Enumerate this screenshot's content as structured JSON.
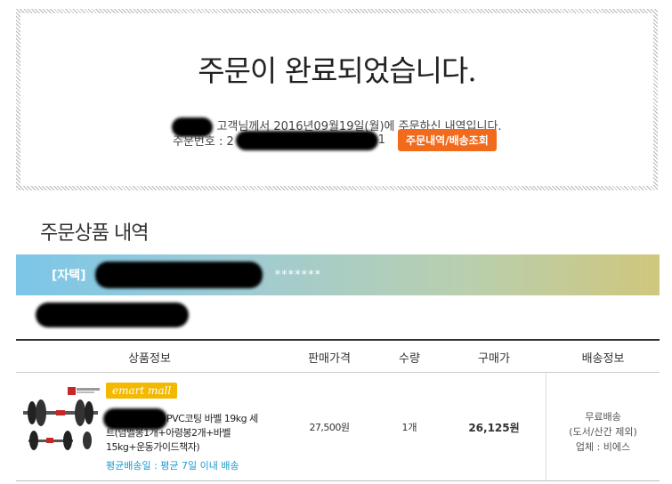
{
  "completion": {
    "title": "주문이 완료되었습니다.",
    "message": "고객님께서 2016년09월19일(월)에 주문하신 내역입니다.",
    "order_label": "주문번호 : 2",
    "order_suffix": "1",
    "order_button": "주문내역/배송조회",
    "button_color": "#f26a1b"
  },
  "section": {
    "title": "주문상품 내역"
  },
  "seller": {
    "prefix": "[자택]",
    "masked": "*******"
  },
  "table": {
    "headers": [
      "상품정보",
      "판매가격",
      "수량",
      "구매가",
      "배송정보"
    ]
  },
  "product": {
    "badge": "emart mall",
    "name": "PVC코팅 바벨 19kg 세트(덤벨봉1개+아령봉2개+바벨15kg+운동가이드책자)",
    "delivery": "평균배송일 : 평균 7일 이내 배송",
    "price": "27,500원",
    "qty": "1개",
    "total": "26,125원",
    "ship_line1": "무료배송",
    "ship_line2": "(도서/산간 제외)",
    "ship_line3": "업체 : 비에스"
  }
}
